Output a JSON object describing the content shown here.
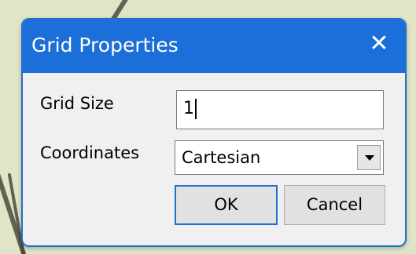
{
  "dialog": {
    "title": "Grid Properties",
    "close_glyph": "✕",
    "close_icon": "close-icon"
  },
  "fields": {
    "grid_size_label": "Grid Size",
    "grid_size_value": "1",
    "coordinates_label": "Coordinates",
    "coordinates_value": "Cartesian",
    "coordinates_arrow_icon": "chevron-down-icon"
  },
  "buttons": {
    "ok_label": "OK",
    "cancel_label": "Cancel"
  },
  "colors": {
    "titlebar": "#1c6fd8",
    "dialog_bg": "#f0f0f0",
    "backdrop": "#dfe5c6"
  }
}
